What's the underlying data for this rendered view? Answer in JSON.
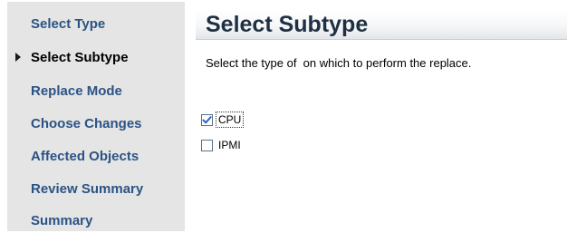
{
  "wizard": {
    "steps": [
      {
        "label": "Select Type",
        "active": false
      },
      {
        "label": "Select Subtype",
        "active": true
      },
      {
        "label": "Replace Mode",
        "active": false
      },
      {
        "label": "Choose Changes",
        "active": false
      },
      {
        "label": "Affected Objects",
        "active": false
      },
      {
        "label": "Review Summary",
        "active": false
      },
      {
        "label": "Summary",
        "active": false
      }
    ]
  },
  "main": {
    "title": "Select Subtype",
    "instructions": "Select the type of  on which to perform the replace.",
    "options": [
      {
        "label": "CPU",
        "checked": true,
        "focused": true
      },
      {
        "label": "IPMI",
        "checked": false,
        "focused": false
      }
    ]
  },
  "colors": {
    "sidebar_bg": "#e5e5e5",
    "step_link": "#2b5384",
    "step_active": "#000000",
    "checkmark": "#2f64c8"
  }
}
